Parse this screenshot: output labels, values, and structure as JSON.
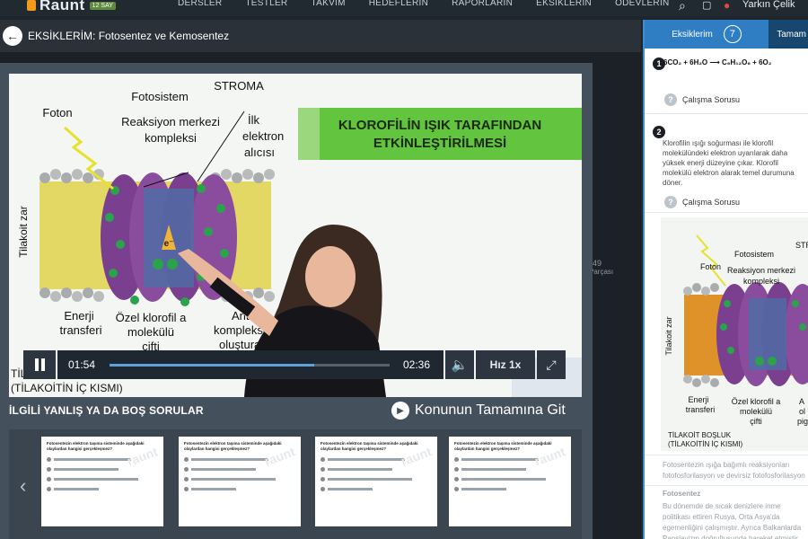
{
  "app": {
    "logo_text": "Raunt",
    "logo_badge": "12 SAY",
    "nav": [
      "DERSLER",
      "TESTLER",
      "TAKVIM",
      "HEDEFLERIN",
      "RAPORLARIN",
      "EKSIKLERIN",
      "ODEVLERIN"
    ],
    "user_name": "Yarkın Çelik"
  },
  "header": {
    "title": "EKSİKLERİM: Fotosentez ve Kemosentez"
  },
  "background": {
    "side_number": "49",
    "side_label": "Parçası"
  },
  "video": {
    "slide": {
      "banner_line1": "KLOROFİLİN IŞIK TARAFINDAN",
      "banner_line2": "ETKİNLEŞTİRİLMESİ",
      "label_fotosistem": "Fotosistem",
      "label_stroma": "STROMA",
      "label_foton": "Foton",
      "label_reaksiyon1": "Reaksiyon merkezi",
      "label_reaksiyon2": "kompleksi",
      "label_ilk1": "İlk",
      "label_ilk2": "elektron",
      "label_ilk3": "alıcısı",
      "label_tilakoit": "Tilakoit zar",
      "label_enerji1": "Enerji",
      "label_enerji2": "transferi",
      "label_ozel1": "Özel klorofil a",
      "label_ozel2": "molekülü",
      "label_ozel3": "çifti",
      "label_anten1": "Anten",
      "label_anten2": "komplekse",
      "label_anten3": "oluşturan",
      "label_bottom1": "TİLAK",
      "label_bottom2": "(TİLAKOİTİN İÇ KISMI)",
      "label_electron": "e⁻"
    },
    "controls": {
      "current_time": "01:54",
      "total_time": "02:36",
      "progress": 0.73,
      "speed_label": "Hız 1x"
    }
  },
  "related": {
    "title": "İLGİLİ YANLIŞ YA DA BOŞ SORULAR",
    "goto_label": "Konunun Tamamına Git",
    "cards": [
      {
        "text": "Fotosentezin elektron taşıma sisteminde aşağıdaki olaylardan hangisi gerçekleşmez?"
      },
      {
        "text": "Fotosentezin elektron taşıma sisteminde aşağıdaki olaylardan hangisi gerçekleşmez?"
      },
      {
        "text": "Fotosentezin elektron taşıma sisteminde aşağıdaki olaylardan hangisi gerçekleşmez?"
      },
      {
        "text": "Fotosentezin elektron taşıma sisteminde aşağıdaki olaylardan hangisi gerçekleşmez?"
      }
    ],
    "watermark": "raunt"
  },
  "panel": {
    "tab_active_label": "Eksiklerim",
    "tab_active_count": "7",
    "tab_other_label": "Tamam",
    "item1": {
      "number": "1",
      "formula": "6CO₂ + 6H₂O ⟶ C₆H₁₂O₆ + 6O₂",
      "study_label": "Çalışma Sorusu"
    },
    "item2": {
      "number": "2",
      "text": "Klorofilin ışığı soğurması ile klorofil molekülündeki elektron uyarılarak daha yüksek enerji düzeyine çıkar. Klorofil molekülü elektron alarak temel durumuna döner.",
      "study_label": "Çalışma Sorusu",
      "thumb": {
        "fotosistem": "Fotosistem",
        "stroma": "STR",
        "foton": "Foton",
        "reaksiyon1": "Reaksiyon merkezi",
        "reaksiyon2": "kompleksi",
        "tilakoit": "Tilakoit zar",
        "enerji1": "Enerji",
        "enerji2": "transferi",
        "ozel1": "Özel klorofil a",
        "ozel2": "molekülü",
        "ozel3": "çifti",
        "anten1": "A",
        "anten2": "ol",
        "anten3": "pig",
        "bottom1": "TİLAKOİT BOŞLUK",
        "bottom2": "(TİLAKOİTİN İÇ KISMI)"
      }
    },
    "item3_text": "Fotosentezin ışığa bağımlı reaksiyonları fotofosforilasyon ve devirsiz fotofosforilasyon",
    "item4_title": "Fotosentez",
    "item4_text": "Bu dönemde de sıcak denizlere inme politikası ettiren Rusya, Orta Asya'da egemenliğini çalışmıştır. Ayrıca Balkanlarda Panslavizm doğrultusunda hareket etmiştir."
  }
}
